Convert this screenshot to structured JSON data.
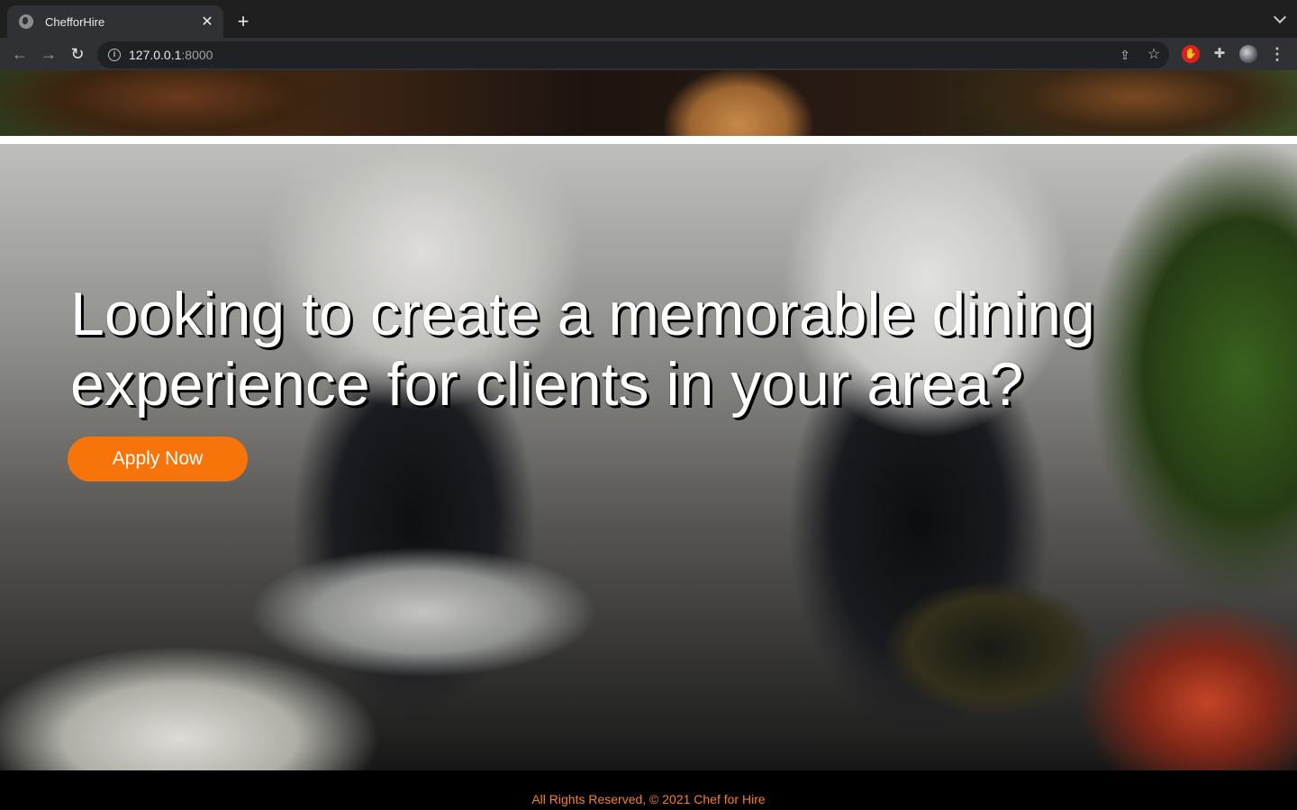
{
  "browser": {
    "tab_title": "ChefforHire",
    "tab_close": "✕",
    "new_tab": "+",
    "url_host": "127.0.0.1",
    "url_port": ":8000"
  },
  "hero": {
    "headline": "Looking to create a memorable dining experience for clients in your area?",
    "cta_label": "Apply Now"
  },
  "footer": {
    "text": "All Rights Reserved, © 2021 Chef for Hire"
  },
  "colors": {
    "accent": "#f7740a",
    "footer_text": "#f7821f"
  }
}
